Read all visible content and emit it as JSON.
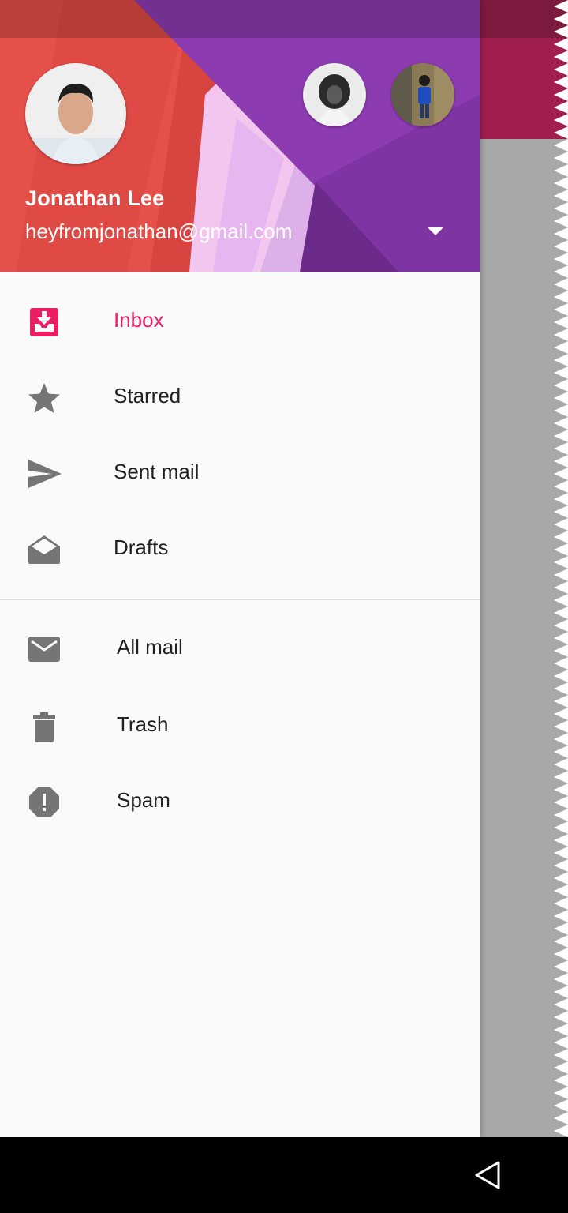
{
  "account": {
    "name": "Jonathan Lee",
    "email": "heyfromjonathan@gmail.com"
  },
  "colors": {
    "accent": "#e91e63",
    "header_red": "#e5514a",
    "header_purple": "#8c3bb0",
    "icon_gray": "#757575"
  },
  "nav": {
    "primary": [
      {
        "label": "Inbox",
        "icon": "inbox-icon",
        "active": true
      },
      {
        "label": "Starred",
        "icon": "star-icon"
      },
      {
        "label": "Sent mail",
        "icon": "send-icon"
      },
      {
        "label": "Drafts",
        "icon": "drafts-icon"
      }
    ],
    "secondary": [
      {
        "label": "All mail",
        "icon": "mail-icon"
      },
      {
        "label": "Trash",
        "icon": "trash-icon"
      },
      {
        "label": "Spam",
        "icon": "spam-icon"
      }
    ]
  },
  "system_nav": {
    "back": "back-icon"
  }
}
